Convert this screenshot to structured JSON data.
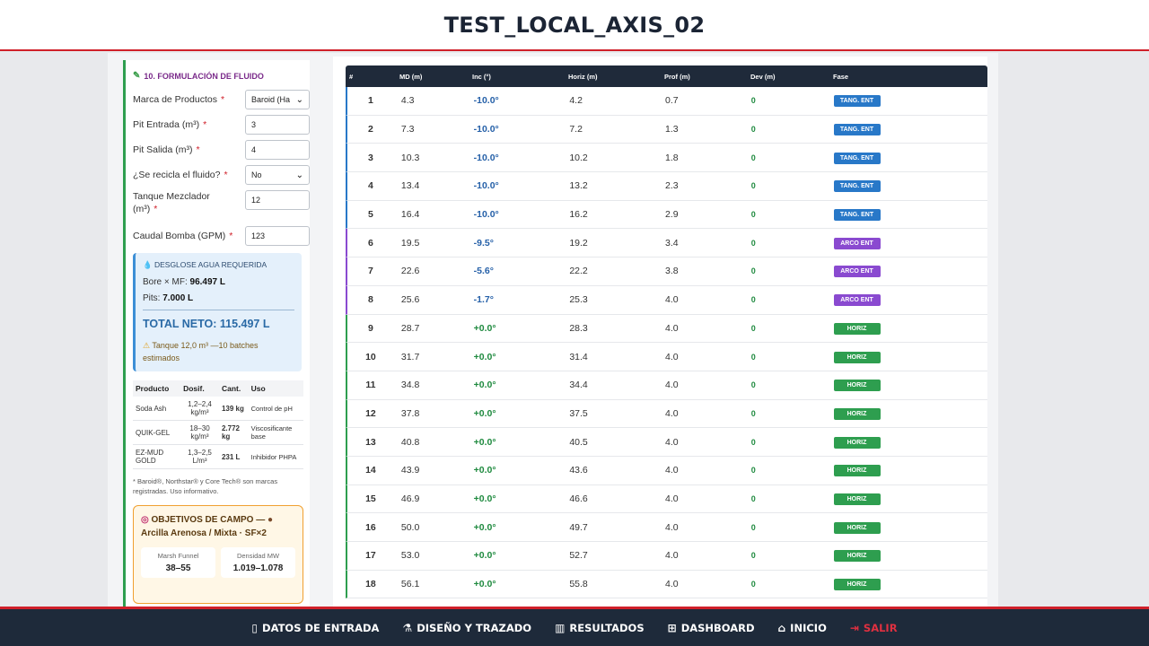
{
  "header": {
    "title": "TEST_LOCAL_AXIS_02"
  },
  "form": {
    "section_title": "10. FORMULACIÓN DE FLUIDO",
    "fields": [
      {
        "label": "Marca de Productos",
        "value": "Baroid (Ha",
        "type": "select"
      },
      {
        "label": "Pit Entrada (m³)",
        "value": "3",
        "type": "input"
      },
      {
        "label": "Pit Salida (m³)",
        "value": "4",
        "type": "input"
      },
      {
        "label": "¿Se recicla el fluido?",
        "value": "No",
        "type": "select"
      },
      {
        "label": "Tanque Mezclador (m³)",
        "value": "12",
        "type": "input"
      },
      {
        "label": "Caudal Bomba (GPM)",
        "value": "123",
        "type": "input"
      }
    ],
    "required_mark": "*"
  },
  "water": {
    "title": "DESGLOSE AGUA REQUERIDA",
    "bore_label": "Bore × MF:",
    "bore_value": "96.497 L",
    "pits_label": "Pits:",
    "pits_value": "7.000 L",
    "total": "TOTAL NETO: 115.497 L",
    "warning": "Tanque 12,0 m³ —10 batches estimados"
  },
  "products": {
    "headers": [
      "Producto",
      "Dosif.",
      "Cant.",
      "Uso"
    ],
    "rows": [
      {
        "name": "Soda Ash",
        "dose": "1,2–2,4 kg/m³",
        "qty": "139 kg",
        "use": "Control de pH"
      },
      {
        "name": "QUIK-GEL",
        "dose": "18–30 kg/m³",
        "qty": "2.772 kg",
        "use": "Viscosificante base"
      },
      {
        "name": "EZ-MUD GOLD",
        "dose": "1,3–2,5 L/m³",
        "qty": "231 L",
        "use": "Inhibidor PHPA"
      }
    ],
    "note": "* Baroid®, Northstar® y Core Tech® son marcas registradas. Uso informativo."
  },
  "objectives": {
    "title": "OBJETIVOS DE CAMPO —",
    "subtitle": "Arcilla Arenosa / Mixta · SF×2",
    "cards": [
      {
        "label": "Marsh Funnel",
        "value": "38–55"
      },
      {
        "label": "Densidad MW",
        "value": "1.019–1.078"
      }
    ]
  },
  "table": {
    "headers": [
      "#",
      "MD (m)",
      "Inc (°)",
      "Horiz (m)",
      "Prof (m)",
      "Dev (m)",
      "Fase"
    ],
    "rows": [
      {
        "n": "1",
        "md": "4.3",
        "inc": "-10.0°",
        "hz": "4.2",
        "pf": "0.7",
        "dev": "0",
        "fase": "TANG. ENT",
        "kind": "t"
      },
      {
        "n": "2",
        "md": "7.3",
        "inc": "-10.0°",
        "hz": "7.2",
        "pf": "1.3",
        "dev": "0",
        "fase": "TANG. ENT",
        "kind": "t"
      },
      {
        "n": "3",
        "md": "10.3",
        "inc": "-10.0°",
        "hz": "10.2",
        "pf": "1.8",
        "dev": "0",
        "fase": "TANG. ENT",
        "kind": "t"
      },
      {
        "n": "4",
        "md": "13.4",
        "inc": "-10.0°",
        "hz": "13.2",
        "pf": "2.3",
        "dev": "0",
        "fase": "TANG. ENT",
        "kind": "t"
      },
      {
        "n": "5",
        "md": "16.4",
        "inc": "-10.0°",
        "hz": "16.2",
        "pf": "2.9",
        "dev": "0",
        "fase": "TANG. ENT",
        "kind": "t"
      },
      {
        "n": "6",
        "md": "19.5",
        "inc": "-9.5°",
        "hz": "19.2",
        "pf": "3.4",
        "dev": "0",
        "fase": "ARCO ENT",
        "kind": "a"
      },
      {
        "n": "7",
        "md": "22.6",
        "inc": "-5.6°",
        "hz": "22.2",
        "pf": "3.8",
        "dev": "0",
        "fase": "ARCO ENT",
        "kind": "a"
      },
      {
        "n": "8",
        "md": "25.6",
        "inc": "-1.7°",
        "hz": "25.3",
        "pf": "4.0",
        "dev": "0",
        "fase": "ARCO ENT",
        "kind": "a"
      },
      {
        "n": "9",
        "md": "28.7",
        "inc": "+0.0°",
        "hz": "28.3",
        "pf": "4.0",
        "dev": "0",
        "fase": "HORIZ",
        "kind": "h"
      },
      {
        "n": "10",
        "md": "31.7",
        "inc": "+0.0°",
        "hz": "31.4",
        "pf": "4.0",
        "dev": "0",
        "fase": "HORIZ",
        "kind": "h"
      },
      {
        "n": "11",
        "md": "34.8",
        "inc": "+0.0°",
        "hz": "34.4",
        "pf": "4.0",
        "dev": "0",
        "fase": "HORIZ",
        "kind": "h"
      },
      {
        "n": "12",
        "md": "37.8",
        "inc": "+0.0°",
        "hz": "37.5",
        "pf": "4.0",
        "dev": "0",
        "fase": "HORIZ",
        "kind": "h"
      },
      {
        "n": "13",
        "md": "40.8",
        "inc": "+0.0°",
        "hz": "40.5",
        "pf": "4.0",
        "dev": "0",
        "fase": "HORIZ",
        "kind": "h"
      },
      {
        "n": "14",
        "md": "43.9",
        "inc": "+0.0°",
        "hz": "43.6",
        "pf": "4.0",
        "dev": "0",
        "fase": "HORIZ",
        "kind": "h"
      },
      {
        "n": "15",
        "md": "46.9",
        "inc": "+0.0°",
        "hz": "46.6",
        "pf": "4.0",
        "dev": "0",
        "fase": "HORIZ",
        "kind": "h"
      },
      {
        "n": "16",
        "md": "50.0",
        "inc": "+0.0°",
        "hz": "49.7",
        "pf": "4.0",
        "dev": "0",
        "fase": "HORIZ",
        "kind": "h"
      },
      {
        "n": "17",
        "md": "53.0",
        "inc": "+0.0°",
        "hz": "52.7",
        "pf": "4.0",
        "dev": "0",
        "fase": "HORIZ",
        "kind": "h"
      },
      {
        "n": "18",
        "md": "56.1",
        "inc": "+0.0°",
        "hz": "55.8",
        "pf": "4.0",
        "dev": "0",
        "fase": "HORIZ",
        "kind": "h"
      }
    ]
  },
  "footer": {
    "items": [
      {
        "label": "DATOS DE ENTRADA",
        "icon": "clipboard-icon",
        "glyph": "▯"
      },
      {
        "label": "DISEÑO Y TRAZADO",
        "icon": "compass-icon",
        "glyph": "⚗"
      },
      {
        "label": "RESULTADOS",
        "icon": "chart-icon",
        "glyph": "▥"
      },
      {
        "label": "DASHBOARD",
        "icon": "grid-icon",
        "glyph": "⊞"
      },
      {
        "label": "INICIO",
        "icon": "home-icon",
        "glyph": "⌂"
      },
      {
        "label": "SALIR",
        "icon": "logout-icon",
        "glyph": "⇥"
      }
    ]
  },
  "colors": {
    "accent_red": "#d0202a",
    "tang": "#2878c8",
    "arco": "#8a4ad0",
    "horiz": "#2e9e4f",
    "navy": "#1e2a3a"
  }
}
